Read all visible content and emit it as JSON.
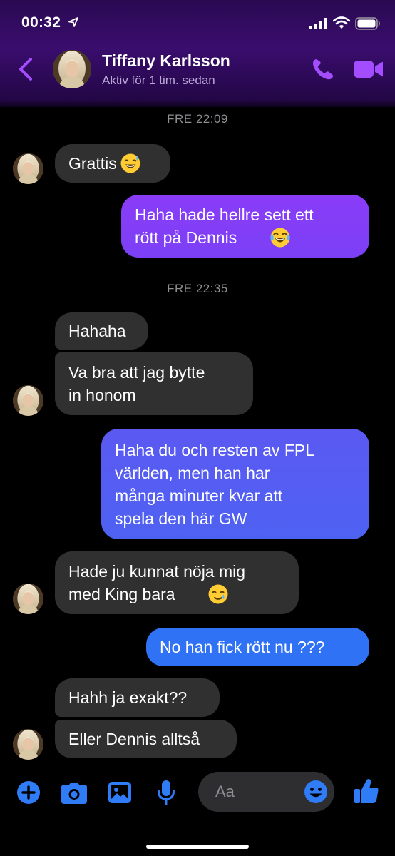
{
  "status_bar": {
    "time": "00:32"
  },
  "header": {
    "name": "Tiffany Karlsson",
    "status": "Aktiv för 1 tim. sedan"
  },
  "colors": {
    "accent": "#a34dff",
    "incoming_bubble": "#303030",
    "outgoing_gradient": [
      "#8a3cf7",
      "#4f5df0",
      "#2f72f6"
    ]
  },
  "timestamps": [
    "FRE 22:09",
    "FRE 22:35"
  ],
  "messages": [
    {
      "from": "them",
      "text": "Grattis",
      "emoji": "sweat-smile"
    },
    {
      "from": "me",
      "text": "Haha hade hellre sett ett\nrött på Dennis",
      "emoji": "tears-of-joy"
    },
    {
      "from": "them",
      "text": "Hahaha"
    },
    {
      "from": "them",
      "text": "Va bra att jag bytte\nin honom"
    },
    {
      "from": "me",
      "text": "Haha du och resten av FPL\nvärlden, men han har\nmånga minuter kvar att\nspela den här GW"
    },
    {
      "from": "them",
      "text": "Hade ju kunnat nöja mig\nmed King bara",
      "emoji": "smiling-tear"
    },
    {
      "from": "me",
      "text": "No han fick rött nu ???"
    },
    {
      "from": "them",
      "text": "Hahh ja exakt??"
    },
    {
      "from": "them",
      "text": "Eller Dennis alltså"
    }
  ],
  "composer": {
    "placeholder": "Aa",
    "icons": [
      "plus-icon",
      "camera-icon",
      "gallery-icon",
      "microphone-icon",
      "emoji-icon",
      "thumbs-up-icon"
    ]
  }
}
